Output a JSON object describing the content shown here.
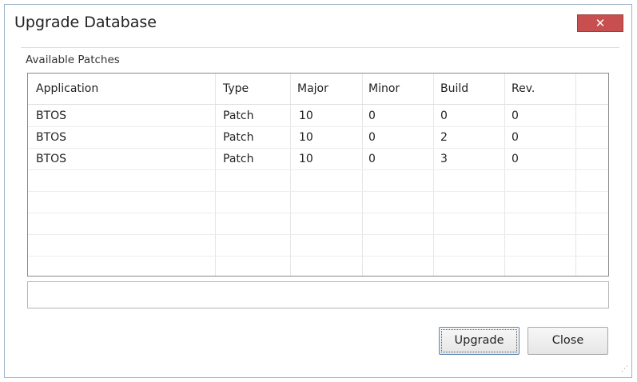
{
  "window": {
    "title": "Upgrade Database",
    "close_icon": "close-icon"
  },
  "group": {
    "label": "Available Patches"
  },
  "grid": {
    "columns": [
      "Application",
      "Type",
      "Major",
      "Minor",
      "Build",
      "Rev."
    ],
    "rows": [
      [
        "BTOS",
        "Patch",
        "10",
        "0",
        "0",
        "0"
      ],
      [
        "BTOS",
        "Patch",
        "10",
        "0",
        "2",
        "0"
      ],
      [
        "BTOS",
        "Patch",
        "10",
        "0",
        "3",
        "0"
      ]
    ]
  },
  "status": {
    "text": ""
  },
  "buttons": {
    "upgrade": "Upgrade",
    "close": "Close"
  },
  "colors": {
    "close_button": "#c74f4f",
    "border": "#9fb4c9",
    "focus_border": "#5b86b6"
  }
}
